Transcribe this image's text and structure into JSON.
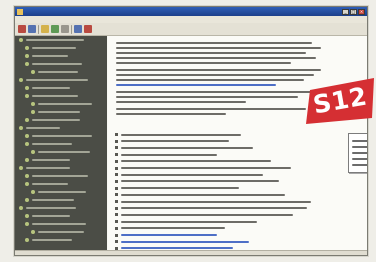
{
  "window": {
    "title": "",
    "controls": {
      "minimize": "_",
      "maximize": "□",
      "close": "×"
    }
  },
  "menus": [],
  "toolbar": {
    "icons": [
      "back-icon",
      "forward-icon",
      "stop-icon",
      "refresh-icon",
      "home-icon",
      "print-icon",
      "options-icon"
    ]
  },
  "sidebar": {
    "items": [
      {
        "name": "node-1"
      },
      {
        "name": "node-2"
      },
      {
        "name": "node-3"
      },
      {
        "name": "node-4"
      },
      {
        "name": "node-5"
      },
      {
        "name": "node-6"
      },
      {
        "name": "node-7"
      },
      {
        "name": "node-8"
      },
      {
        "name": "node-9"
      },
      {
        "name": "node-10"
      },
      {
        "name": "node-11"
      },
      {
        "name": "node-12"
      },
      {
        "name": "node-13"
      },
      {
        "name": "node-14"
      },
      {
        "name": "node-15"
      },
      {
        "name": "node-16"
      },
      {
        "name": "node-17"
      },
      {
        "name": "node-18"
      },
      {
        "name": "node-19"
      },
      {
        "name": "node-20"
      },
      {
        "name": "node-21"
      },
      {
        "name": "node-22"
      },
      {
        "name": "node-23"
      },
      {
        "name": "node-24"
      },
      {
        "name": "node-25"
      },
      {
        "name": "node-26"
      }
    ]
  },
  "main": {
    "section_title": "",
    "list_item_count": 18
  },
  "badge": {
    "text": "S12",
    "color": "#d52f33"
  },
  "colors": {
    "titlebar": "#1c3f8b",
    "sidebar": "#4b4d46",
    "link": "#4e6fc6"
  }
}
